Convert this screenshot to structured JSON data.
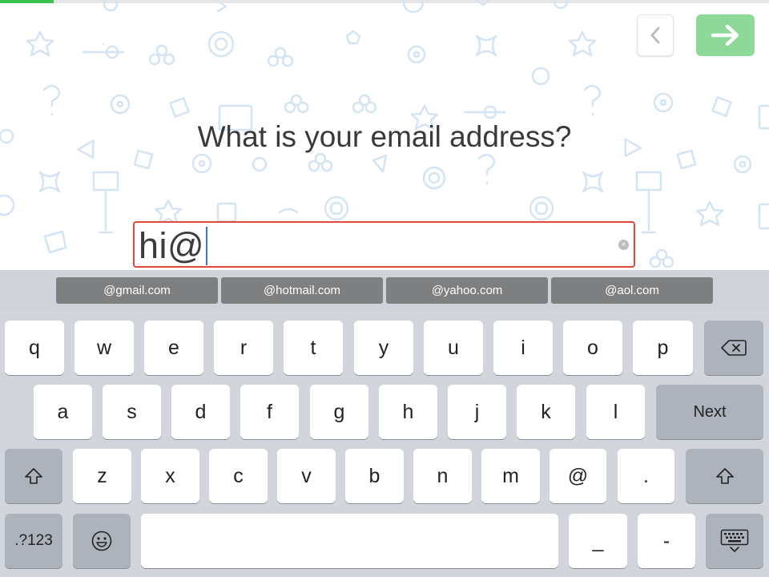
{
  "progress": {
    "fraction": 0.07,
    "color": "#3cc24f"
  },
  "nav": {
    "back_icon": "chevron-left",
    "next_icon": "arrow-right"
  },
  "question": "What is your email address?",
  "email_input": {
    "value": "hi@"
  },
  "suggestions": [
    "@gmail.com",
    "@hotmail.com",
    "@yahoo.com",
    "@aol.com"
  ],
  "keyboard": {
    "row1": [
      "q",
      "w",
      "e",
      "r",
      "t",
      "y",
      "u",
      "i",
      "o",
      "p"
    ],
    "row2": [
      "a",
      "s",
      "d",
      "f",
      "g",
      "h",
      "j",
      "k",
      "l"
    ],
    "row3": [
      "z",
      "x",
      "c",
      "v",
      "b",
      "n",
      "m",
      "@",
      "."
    ],
    "next_label": "Next",
    "numbers_label": ".?123",
    "underscore_label": "_",
    "dash_label": "-"
  }
}
